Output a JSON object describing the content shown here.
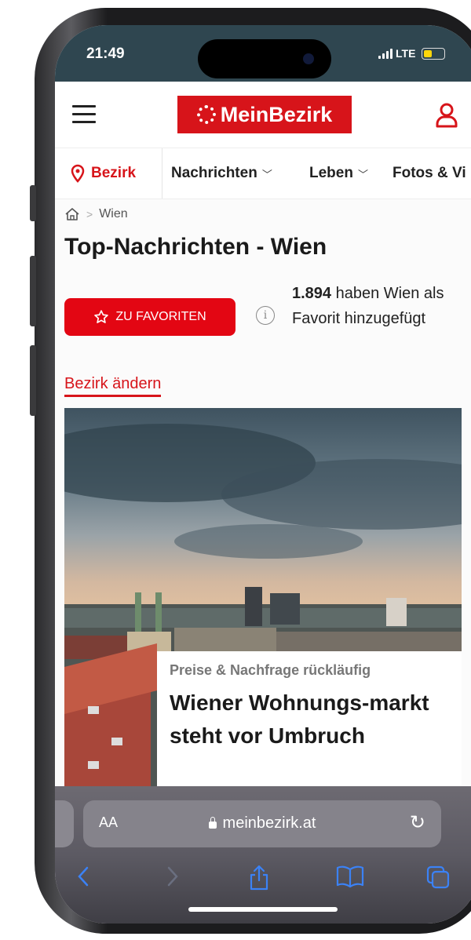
{
  "status_bar": {
    "time": "21:49",
    "network": "LTE"
  },
  "header": {
    "logo_text": "MeinBezirk",
    "menu_icon": "hamburger-icon",
    "user_icon": "user-icon"
  },
  "nav": {
    "location_label": "Bezirk",
    "items": [
      {
        "label": "Nachrichten"
      },
      {
        "label": "Leben"
      },
      {
        "label": "Fotos & Vi"
      }
    ]
  },
  "breadcrumb": {
    "home_icon": "home-icon",
    "current": "Wien"
  },
  "page": {
    "title": "Top-Nachrichten - Wien",
    "favorite_button": "ZU FAVORITEN",
    "favorite_count": "1.894",
    "favorite_text": "haben Wien als Favorit hinzugefügt",
    "change_district": "Bezirk ändern"
  },
  "article": {
    "kicker": "Preise & Nachfrage rückläufig",
    "headline": "Wiener Wohnungs-markt steht vor Umbruch"
  },
  "browser": {
    "text_size_label": "AA",
    "url": "meinbezirk.at"
  },
  "colors": {
    "brand_red": "#d7141a",
    "status_bar": "#2f4650",
    "toolbar_blue": "#3b82f6"
  }
}
